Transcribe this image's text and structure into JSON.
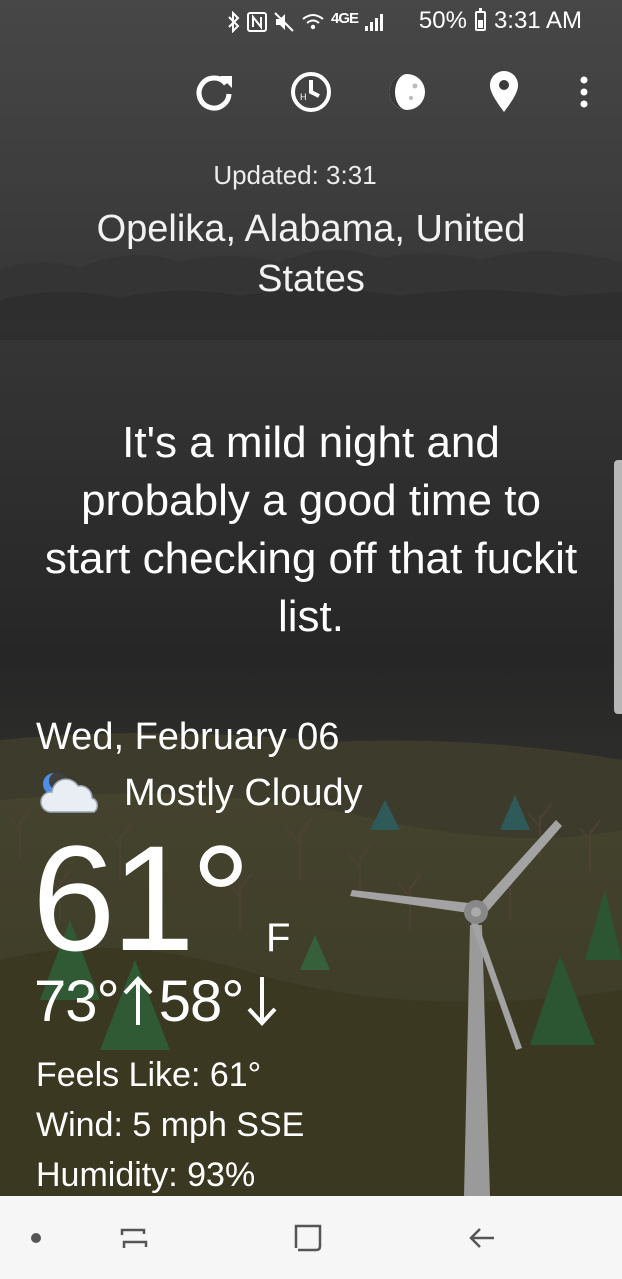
{
  "status_bar": {
    "network": "4GE",
    "battery": "50%",
    "battery_level": 0.5,
    "time": "3:31 AM"
  },
  "toolbar": {
    "icons": [
      "refresh-icon",
      "history-icon",
      "moon-phase-icon",
      "location-pin-icon",
      "more-vert-icon"
    ]
  },
  "weather": {
    "updated": "Updated: 3:31",
    "location": "Opelika, Alabama, United States",
    "message": "It's a mild night and probably a good time to start checking off that fuckit list.",
    "date": "Wed, February 06",
    "condition": "Mostly Cloudy",
    "condition_icon": "partly-cloudy-night-icon",
    "temperature": "61°",
    "unit": "F",
    "high": "73°",
    "low": "58°",
    "feels_like": "Feels Like: 61°",
    "wind": "Wind: 5 mph SSE",
    "humidity": "Humidity: 93%"
  },
  "nav_bar": {
    "icons": [
      "dot-icon",
      "recents-icon",
      "home-icon",
      "back-icon"
    ]
  },
  "colors": {
    "sky_top": "#444444",
    "sky_bottom": "#262626",
    "ground": "#3b3a22",
    "nav_background": "#f6f6f6",
    "nav_icon": "#555555"
  }
}
